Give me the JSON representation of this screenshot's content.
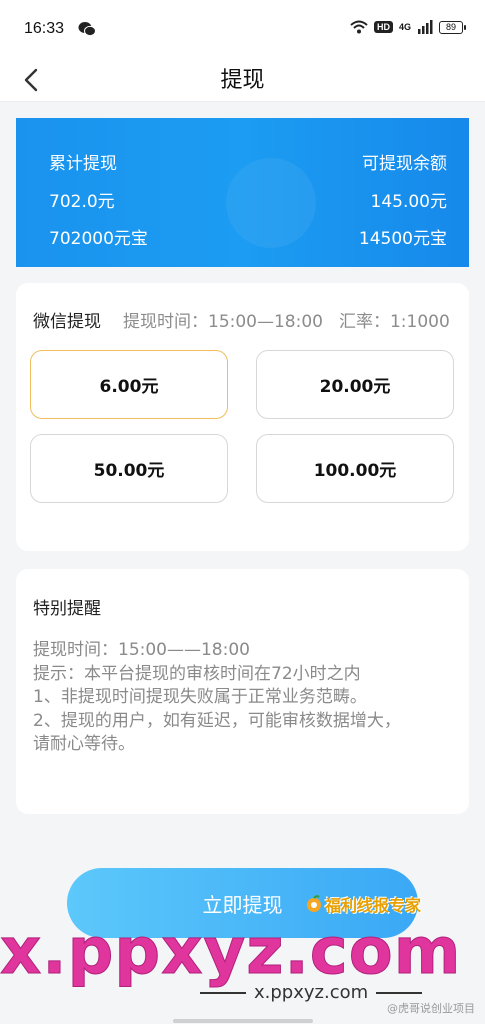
{
  "status_bar": {
    "time": "16:33",
    "hd_label": "HD",
    "network_label": "4G",
    "battery": "89"
  },
  "nav": {
    "title": "提现"
  },
  "balance": {
    "total_label": "累计提现",
    "total_yuan": "702.0元",
    "total_bao": "702000元宝",
    "available_label": "可提现余额",
    "available_yuan": "145.00元",
    "available_bao": "14500元宝",
    "bg_color": "#1a93ee"
  },
  "withdraw": {
    "title": "微信提现",
    "time_info": "提现时间：15:00—18:00",
    "rate_info": "汇率：1:1000",
    "options": [
      "6.00元",
      "20.00元",
      "50.00元",
      "100.00元"
    ],
    "selected_index": 0,
    "selected_border_color": "#f0bd5c"
  },
  "reminder": {
    "title": "特别提醒",
    "lines": [
      "提现时间：15:00——18:00",
      "提示：本平台提现的审核时间在72小时之内",
      "1、非提现时间提现失败属于正常业务范畴。",
      "2、提现的用户，如有延迟，可能审核数据增大，",
      "请耐心等待。"
    ]
  },
  "submit": {
    "label": "立即提现",
    "color": "#3aa8f5"
  },
  "watermark": {
    "brand": "福利线报专家",
    "big": "x.ppxyz.com",
    "small": "x.ppxyz.com",
    "credit": "@虎哥说创业项目"
  }
}
